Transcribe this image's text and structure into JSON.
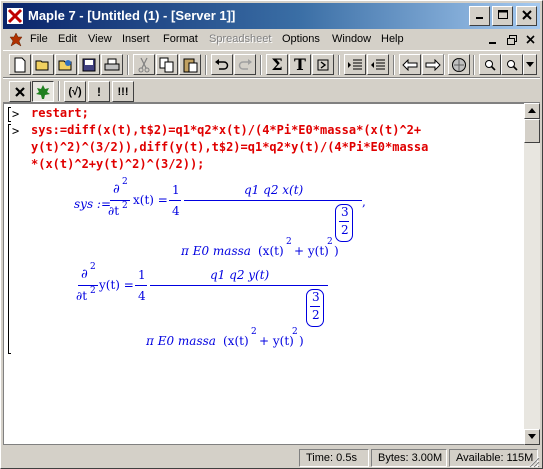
{
  "window": {
    "title": "Maple 7  - [Untitled (1) - [Server 1]]"
  },
  "menu": [
    "File",
    "Edit",
    "View",
    "Insert",
    "Format",
    "Spreadsheet",
    "Options",
    "Window",
    "Help"
  ],
  "toolbar2": {
    "exec_label": "(√)",
    "bang_label": "!",
    "triple_bang_label": "!!!"
  },
  "worksheet": {
    "prompt": ">",
    "line1": "restart;",
    "line2a": "sys:=diff(x(t),t$2)=q1*q2*x(t)/(4*Pi*E0*massa*(x(t)^2+",
    "line2b": "y(t)^2)^(3/2)),diff(y(t),t$2)=q1*q2*y(t)/(4*Pi*E0*massa",
    "line2c": "*(x(t)^2+y(t)^2)^(3/2));",
    "output": {
      "sys_label": "sys :=",
      "d2": "∂",
      "sup2": "2",
      "dt2": "∂t",
      "x_of_t": "x(t) =",
      "y_of_t": "y(t) =",
      "one": "1",
      "four": "4",
      "num_x": "q1 q2 x(t)",
      "num_y": "q1 q2 y(t)",
      "three": "3",
      "two": "2",
      "comma": ",",
      "den_prefix": "π E0 massa",
      "den_x": "(x(t)",
      "den_plus": "+ y(t)",
      "den_close": ")"
    }
  },
  "status": {
    "time": "Time:  0.5s",
    "bytes": "Bytes: 3.00M",
    "available": "Available: 115M"
  }
}
